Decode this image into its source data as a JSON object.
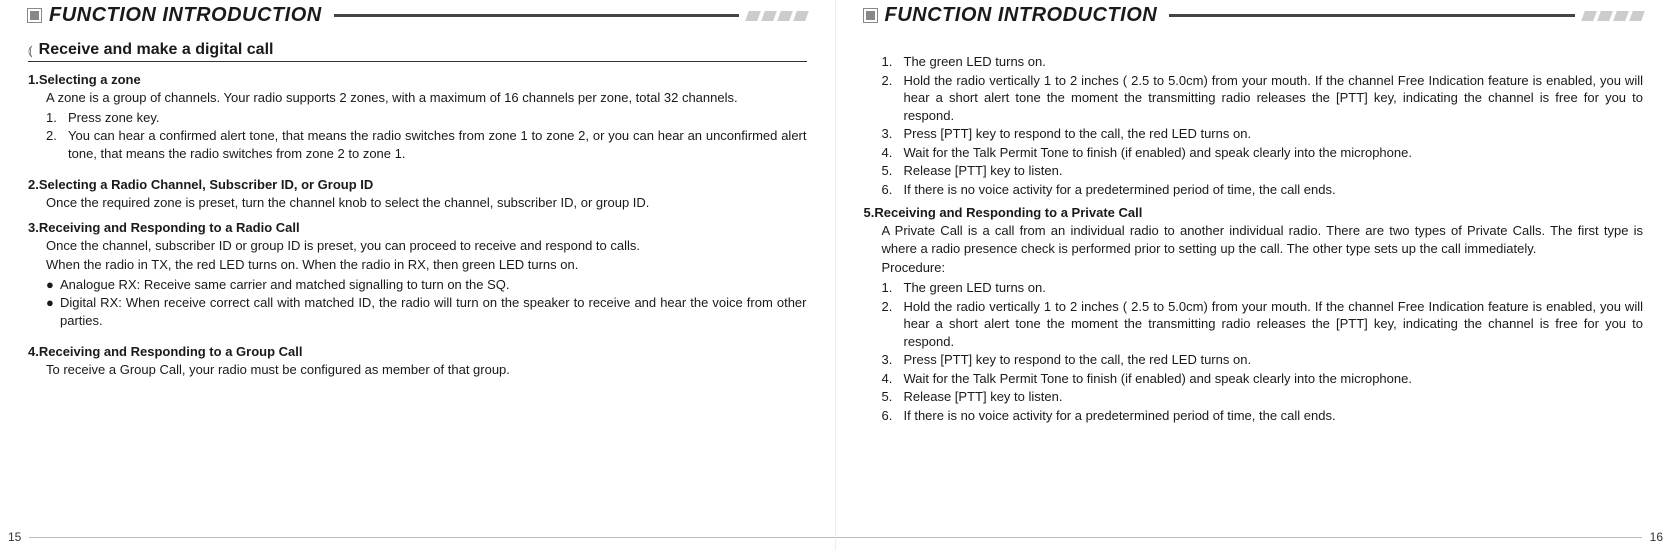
{
  "header_title": "FUNCTION INTRODUCTION",
  "left": {
    "section_title": "Receive and make a digital call",
    "s1": {
      "h": "1.Selecting a zone",
      "p": "A zone is a group of channels. Your radio supports 2 zones, with a maximum of 16 channels per zone, total 32 channels.",
      "li1_n": "1.",
      "li1_t": "Press zone key.",
      "li2_n": "2.",
      "li2_t": "You can hear a confirmed alert tone, that means the radio switches from zone 1 to zone 2, or you can hear an unconfirmed alert tone, that means the radio switches from zone 2 to zone 1."
    },
    "s2": {
      "h": "2.Selecting a Radio Channel, Subscriber ID, or Group ID",
      "p": "Once the required zone is preset, turn the channel knob to select the channel, subscriber ID, or group ID."
    },
    "s3": {
      "h": "3.Receiving and Responding to a Radio Call",
      "p1": "Once the channel, subscriber ID or group ID is preset, you can proceed to receive and respond to calls.",
      "p2": "When the radio in TX, the red LED turns on. When the radio in RX, then green LED turns on.",
      "b1": "Analogue RX:  Receive same carrier and matched signalling to turn on the SQ.",
      "b2": "Digital RX:  When receive correct call with matched ID, the radio will turn on the speaker to receive and hear the voice from other parties."
    },
    "s4": {
      "h": "4.Receiving and Responding to a Group Call",
      "p": "To receive a Group Call, your radio must be configured as member of that group."
    },
    "page_num": "15"
  },
  "right": {
    "list1": {
      "n1": "1.",
      "t1": "The green LED turns on.",
      "n2": "2.",
      "t2": "Hold the radio vertically 1 to 2 inches ( 2.5 to 5.0cm) from your mouth. If the channel Free Indication feature is enabled, you will hear a short alert tone the moment the transmitting radio releases the [PTT] key, indicating the channel is free for you to respond.",
      "n3": "3.",
      "t3": "Press [PTT] key to respond to the call, the red LED turns on.",
      "n4": "4.",
      "t4": "Wait for the Talk Permit Tone to finish (if enabled) and speak clearly into the microphone.",
      "n5": "5.",
      "t5": "Release [PTT] key to listen.",
      "n6": "6.",
      "t6": "If there is no voice activity for a predetermined period of time, the call ends."
    },
    "s5": {
      "h": "5.Receiving and Responding to a Private Call",
      "p1": "A Private Call is a call from an individual radio to another individual radio. There are two types of Private Calls. The first type is where a radio presence check is performed prior to setting up the call. The other type sets up the call immediately.",
      "proc": "Procedure:",
      "n1": "1.",
      "t1": "The green LED turns on.",
      "n2": "2.",
      "t2": "Hold the radio vertically 1 to 2 inches ( 2.5 to 5.0cm) from your mouth. If the channel Free Indication feature is enabled, you will hear a short alert tone the moment the transmitting radio releases the [PTT] key, indicating the channel is free for you to respond.",
      "n3": "3.",
      "t3": "Press [PTT] key to respond to the call, the red LED turns on.",
      "n4": "4.",
      "t4": "Wait for the Talk Permit Tone to finish (if enabled) and speak clearly into the microphone.",
      "n5": "5.",
      "t5": "Release [PTT] key to listen.",
      "n6": "6.",
      "t6": "If there is no voice activity for a predetermined period of time, the call ends."
    },
    "page_num": "16"
  }
}
